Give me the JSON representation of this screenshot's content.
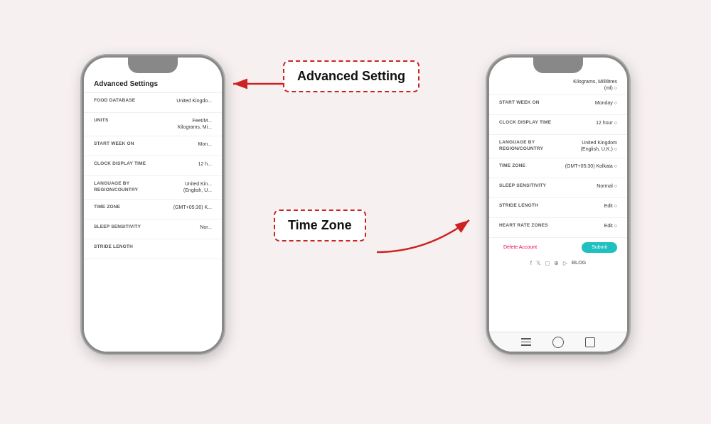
{
  "background": "#f7f0f0",
  "annotations": {
    "advanced_setting": "Advanced Setting",
    "time_zone": "Time Zone"
  },
  "phone_left": {
    "title": "Advanced Settings",
    "rows": [
      {
        "label": "FOOD DATABASE",
        "value": "United Kingdo..."
      },
      {
        "label": "UNITS",
        "value": "Feet/M\nKilograms, Mi..."
      },
      {
        "label": "START WEEK ON",
        "value": "Mon..."
      },
      {
        "label": "CLOCK DISPLAY TIME",
        "value": "12 h..."
      },
      {
        "label": "LANGUAGE BY\nREGION/COUNTRY",
        "value": "United Kin...\n(English, U..."
      },
      {
        "label": "TIME ZONE",
        "value": "(GMT+05:30) K..."
      },
      {
        "label": "SLEEP SENSITIVITY",
        "value": "Nor..."
      },
      {
        "label": "STRIDE LENGTH",
        "value": ""
      }
    ]
  },
  "phone_right": {
    "top_value": "Kilograms, Millilitres\n(ml)",
    "rows": [
      {
        "label": "START WEEK ON",
        "value": "Monday"
      },
      {
        "label": "CLOCK DISPLAY TIME",
        "value": "12 hour"
      },
      {
        "label": "LANGUAGE BY\nREGION/COUNTRY",
        "value": "United Kingdom\n(English, U.K.)"
      },
      {
        "label": "TIME ZONE",
        "value": "(GMT+05:30) Kolkata"
      },
      {
        "label": "SLEEP SENSITIVITY",
        "value": "Normal"
      },
      {
        "label": "STRIDE LENGTH",
        "value": "Edit"
      },
      {
        "label": "HEART RATE ZONES",
        "value": "Edit"
      }
    ],
    "buttons": {
      "delete": "Delete Account",
      "submit": "Submit"
    },
    "social": [
      "f",
      "🐦",
      "📷",
      "pinterest",
      "▶",
      "BLOG"
    ]
  }
}
